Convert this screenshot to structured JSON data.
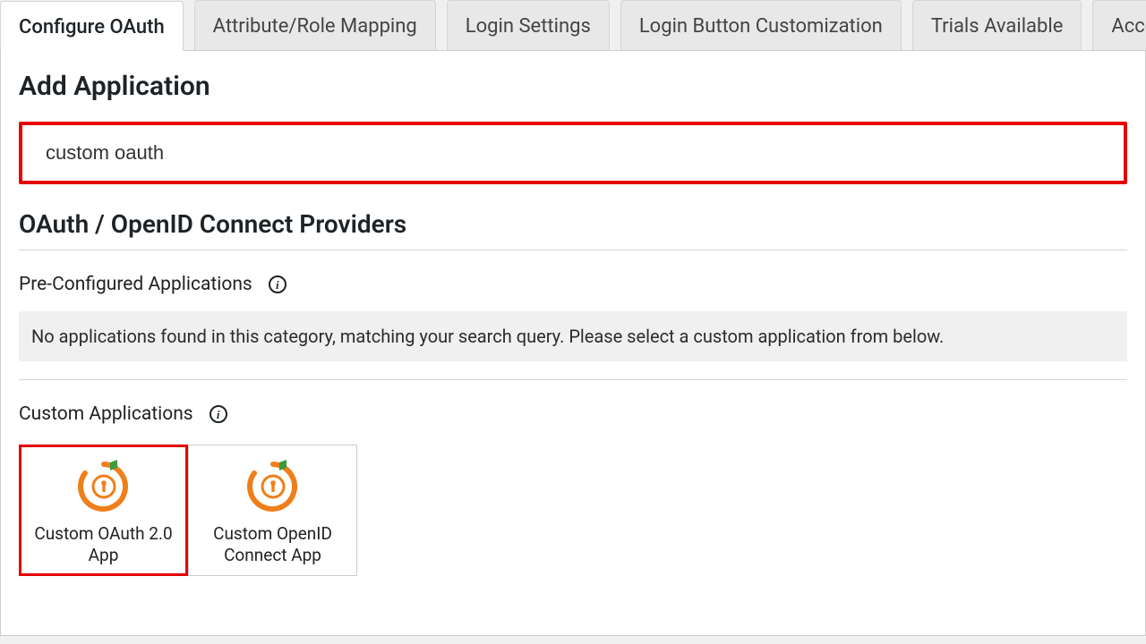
{
  "tabs": [
    {
      "label": "Configure OAuth",
      "active": true
    },
    {
      "label": "Attribute/Role Mapping"
    },
    {
      "label": "Login Settings"
    },
    {
      "label": "Login Button Customization"
    },
    {
      "label": "Trials Available"
    },
    {
      "label": "Account Setu"
    }
  ],
  "page_title": "Add Application",
  "search": {
    "value": "custom oauth"
  },
  "providers_title": "OAuth / OpenID Connect Providers",
  "preconfigured": {
    "title": "Pre-Configured Applications",
    "empty_message": "No applications found in this category, matching your search query. Please select a custom application from below."
  },
  "custom": {
    "title": "Custom Applications",
    "apps": [
      {
        "label": "Custom OAuth 2.0 App",
        "selected": true
      },
      {
        "label": "Custom OpenID Connect App"
      }
    ]
  }
}
